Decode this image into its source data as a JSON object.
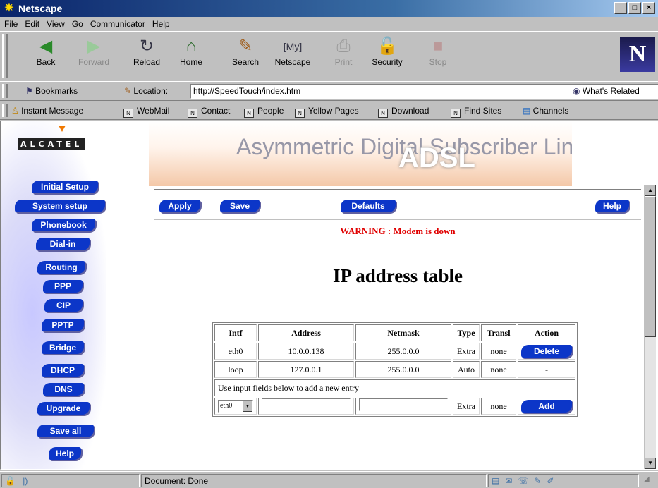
{
  "window": {
    "title": "Netscape",
    "controls": [
      "_",
      "□",
      "×"
    ]
  },
  "menu": [
    "File",
    "Edit",
    "View",
    "Go",
    "Communicator",
    "Help"
  ],
  "toolbar": {
    "buttons": [
      {
        "label": "Back",
        "icon": "back-arrow-icon",
        "enabled": true
      },
      {
        "label": "Forward",
        "icon": "forward-arrow-icon",
        "enabled": false
      },
      {
        "label": "Reload",
        "icon": "reload-icon",
        "enabled": true
      },
      {
        "label": "Home",
        "icon": "home-icon",
        "enabled": true
      },
      {
        "label": "Search",
        "icon": "search-icon",
        "enabled": true
      },
      {
        "label": "Netscape",
        "icon": "my-netscape-icon",
        "enabled": true
      },
      {
        "label": "Print",
        "icon": "print-icon",
        "enabled": false
      },
      {
        "label": "Security",
        "icon": "security-lock-icon",
        "enabled": true
      },
      {
        "label": "Stop",
        "icon": "stop-icon",
        "enabled": false
      }
    ],
    "logo": "N"
  },
  "location": {
    "bookmarks_label": "Bookmarks",
    "location_label": "Location:",
    "url": "http://SpeedTouch/index.htm",
    "related_label": "What's Related"
  },
  "personal_toolbar": [
    "Instant Message",
    "WebMail",
    "Contact",
    "People",
    "Yellow Pages",
    "Download",
    "Find Sites",
    "Channels"
  ],
  "sidebar": {
    "brand": "ALCATEL",
    "menu": [
      "Initial Setup",
      "System setup",
      "Phonebook",
      "Dial-in",
      "Routing",
      "PPP",
      "CIP",
      "PPTP",
      "Bridge",
      "DHCP",
      "DNS",
      "Upgrade",
      "Save all",
      "Help"
    ]
  },
  "banner": {
    "text_back": "Asymmetric Digital Subscriber Line",
    "text_front": "ADSL"
  },
  "actions": {
    "apply": "Apply",
    "save": "Save",
    "defaults": "Defaults",
    "help": "Help"
  },
  "warning": "WARNING : Modem is down",
  "page_title": "IP address table",
  "table": {
    "headers": [
      "Intf",
      "Address",
      "Netmask",
      "Type",
      "Transl",
      "Action"
    ],
    "rows": [
      {
        "intf": "eth0",
        "address": "10.0.0.138",
        "netmask": "255.0.0.0",
        "type": "Extra",
        "transl": "none",
        "action": "Delete"
      },
      {
        "intf": "loop",
        "address": "127.0.0.1",
        "netmask": "255.0.0.0",
        "type": "Auto",
        "transl": "none",
        "action": "-"
      }
    ],
    "add_hint": "Use input fields below to add a new entry",
    "new_entry": {
      "intf_selected": "eth0",
      "type": "Extra",
      "transl": "none",
      "action": "Add"
    }
  },
  "status": {
    "text": "Document: Done"
  },
  "colors": {
    "button_blue": "#0c36c8",
    "warning_red": "#e00000",
    "title_bar": "#0a246a"
  }
}
